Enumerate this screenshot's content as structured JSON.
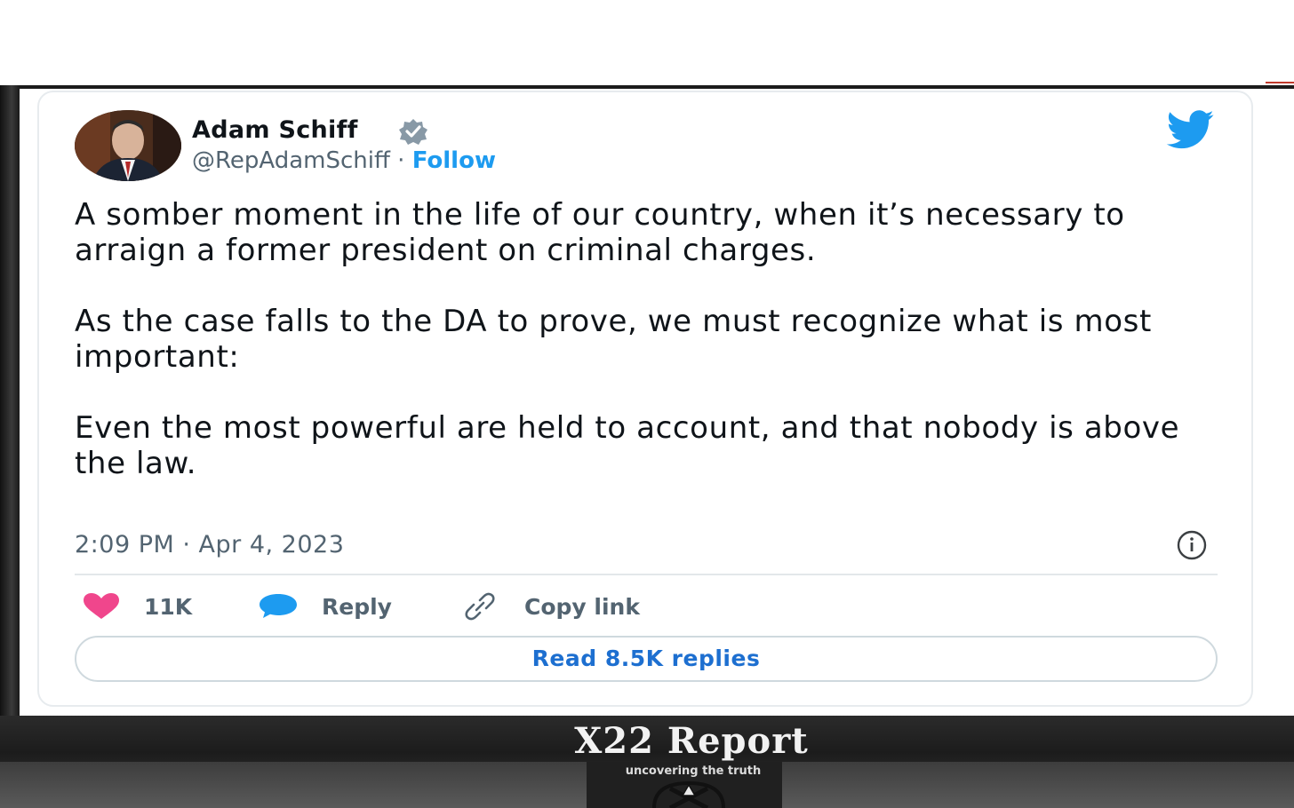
{
  "tweet": {
    "author_name": "Adam Schiff",
    "handle": "@RepAdamSchiff",
    "separator": "·",
    "follow_label": "Follow",
    "paragraphs": [
      "A somber moment in the life of our country, when it’s necessary to arraign a former president on criminal charges.",
      "As the case falls to the DA to prove, we must recognize what is most important:",
      "Even the most powerful are held to account, and that nobody is above the law."
    ],
    "timestamp": "2:09 PM · Apr 4, 2023",
    "actions": {
      "likes": "11K",
      "reply_label": "Reply",
      "copy_link_label": "Copy link"
    },
    "read_replies_label": "Read 8.5K replies"
  },
  "overlay": {
    "brand": "X22 Report",
    "tagline": "uncovering the truth"
  },
  "icons": {
    "heart": "heart-icon",
    "reply": "speech-bubble-icon",
    "link": "link-icon",
    "verified": "verified-badge-icon",
    "bird": "twitter-bird-icon",
    "info": "info-icon"
  },
  "colors": {
    "twitter_blue": "#1d9bf0",
    "like_pink": "#f0468c",
    "text_dark": "#0f1419",
    "text_gray": "#536471"
  }
}
